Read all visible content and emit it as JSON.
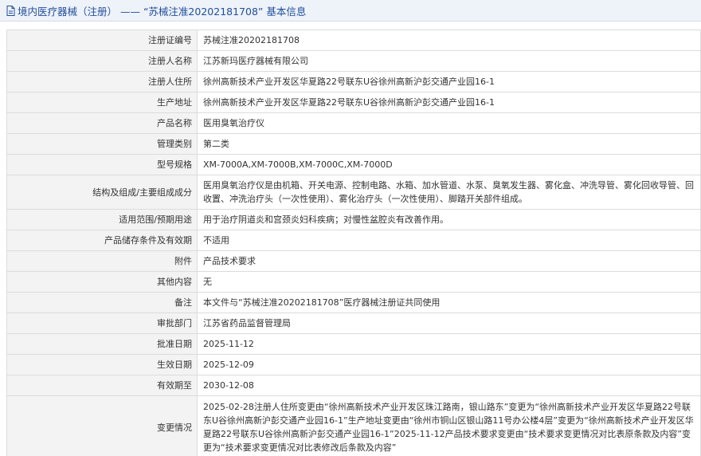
{
  "header": {
    "icon": "document-icon",
    "title": "境内医疗器械（注册） —— “苏械注准20202181708” 基本信息"
  },
  "rows": [
    {
      "label": "注册证编号",
      "value": "苏械注准20202181708"
    },
    {
      "label": "注册人名称",
      "value": "江苏新玛医疗器械有限公司"
    },
    {
      "label": "注册人住所",
      "value": "徐州高新技术产业开发区华夏路22号联东U谷徐州高新沪彭交通产业园16-1"
    },
    {
      "label": "生产地址",
      "value": "徐州高新技术产业开发区华夏路22号联东U谷徐州高新沪彭交通产业园16-1"
    },
    {
      "label": "产品名称",
      "value": "医用臭氧治疗仪"
    },
    {
      "label": "管理类别",
      "value": "第二类"
    },
    {
      "label": "型号规格",
      "value": "XM-7000A,XM-7000B,XM-7000C,XM-7000D"
    },
    {
      "label": "结构及组成/主要组成成分",
      "value": "医用臭氧治疗仪是由机箱、开关电源、控制电路、水箱、加水管道、水泵、臭氧发生器、雾化盒、冲洗导管、雾化回收导管、回收置、冲洗治疗头（一次性使用）、雾化治疗头（一次性使用）、脚踏开关部件组成。"
    },
    {
      "label": "适用范围/预期用途",
      "value": "用于治疗阴道炎和宫颈炎妇科疾病；对慢性盆腔炎有改善作用。"
    },
    {
      "label": "产品储存条件及有效期",
      "value": "不适用"
    },
    {
      "label": "附件",
      "value": "产品技术要求"
    },
    {
      "label": "其他内容",
      "value": "无"
    },
    {
      "label": "备注",
      "value": "本文件与“苏械注准20202181708”医疗器械注册证共同使用"
    },
    {
      "label": "审批部门",
      "value": "江苏省药品监督管理局"
    },
    {
      "label": "批准日期",
      "value": "2025-11-12"
    },
    {
      "label": "生效日期",
      "value": "2025-12-09"
    },
    {
      "label": "有效期至",
      "value": "2030-12-08"
    },
    {
      "label": "变更情况",
      "value": "2025-02-28注册人住所变更由“徐州高新技术产业开发区珠江路南，银山路东”变更为“徐州高新技术产业开发区华夏路22号联东U谷徐州高新沪彭交通产业园16-1”生产地址变更由“徐州市铜山区银山路11号办公楼4层”变更为“徐州高新技术产业开发区华夏路22号联东U谷徐州高新沪彭交通产业园16-1”2025-11-12产品技术要求变更由“技术要求变更情况对比表原条款及内容”变更为“技术要求变更情况对比表修改后条款及内容”"
    }
  ]
}
